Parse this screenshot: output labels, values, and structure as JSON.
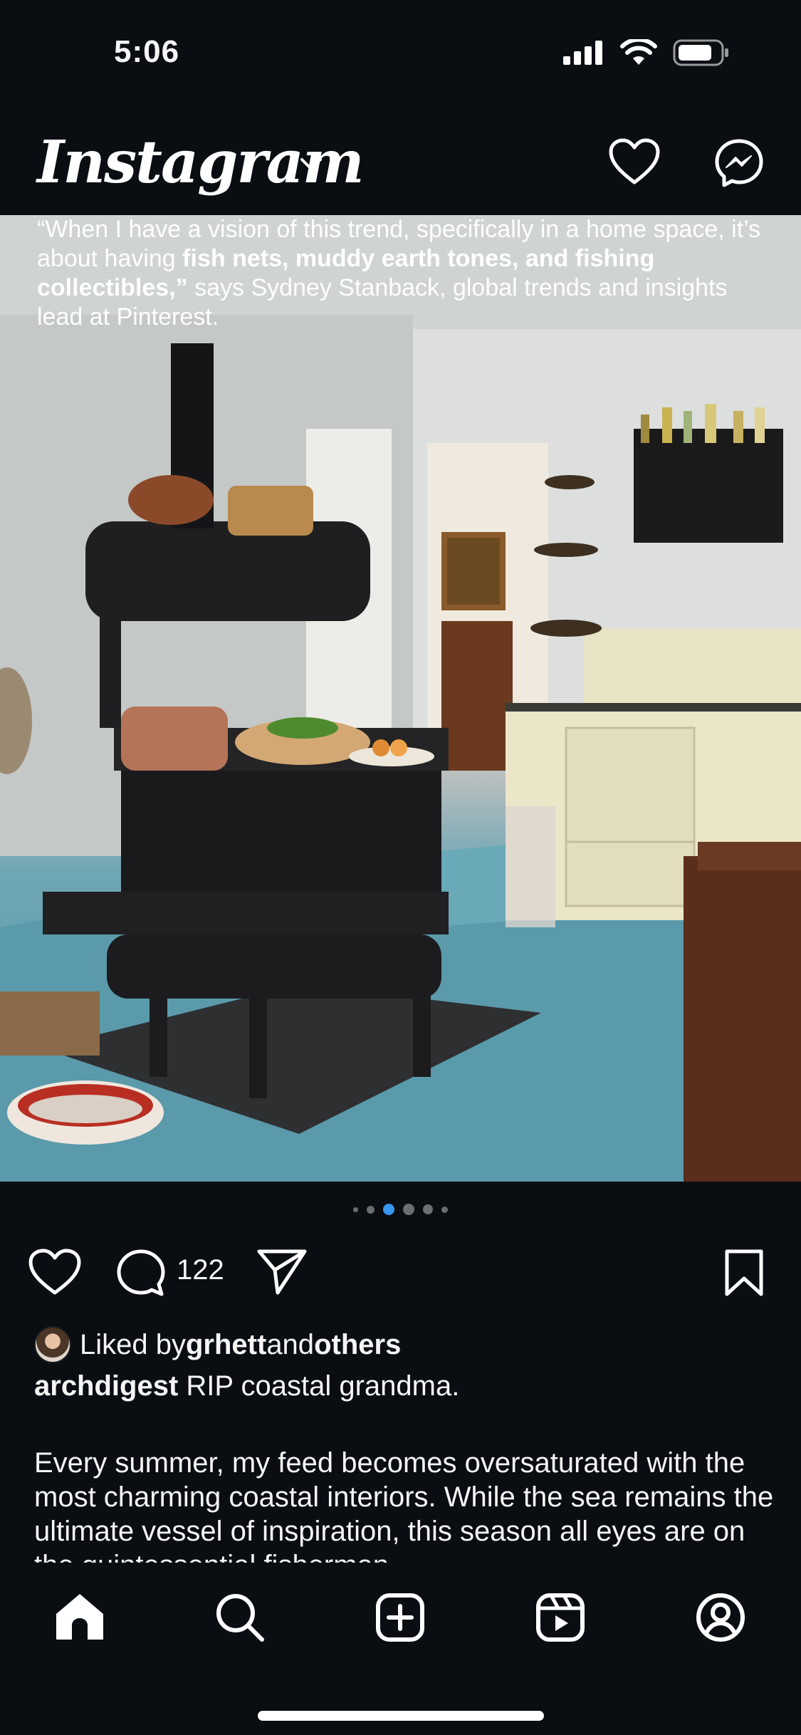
{
  "status_bar": {
    "time": "5:06"
  },
  "header": {
    "logo": "Instagram"
  },
  "post": {
    "image_text": {
      "part1": "“When I have a vision of this trend, specifically in a home space, it’s about having ",
      "bold": "fish nets, muddy earth tones, and fishing collectibles,”",
      "part2": " says Sydney Stanback, global trends and insights lead at Pinterest."
    },
    "carousel": {
      "count": 6,
      "active": 2
    },
    "comment_count": "122",
    "likes": {
      "prefix": "Liked by ",
      "user": "grhett",
      "middle": " and ",
      "others": "others"
    },
    "caption": {
      "username": "archdigest",
      "text": " RIP coastal grandma.",
      "body": "Every summer, my feed becomes oversaturated with the most charming coastal interiors. While the sea remains the ultimate vessel of inspiration, this season all eyes are on the quintessential fisherman"
    }
  },
  "colors": {
    "background": "#0a0e13",
    "accent_blue": "#3897f0",
    "floor_teal": "#5a9aab"
  }
}
